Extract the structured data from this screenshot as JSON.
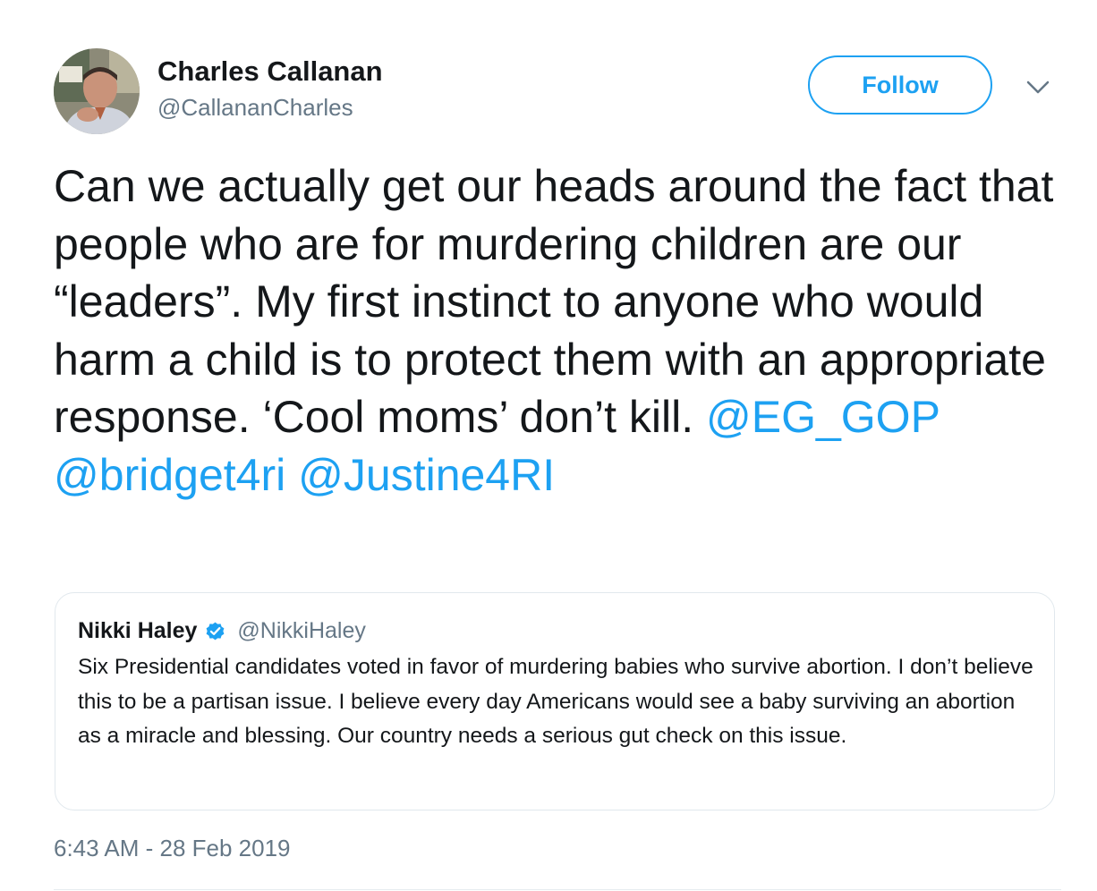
{
  "author": {
    "display_name": "Charles Callanan",
    "handle": "@CallananCharles"
  },
  "actions": {
    "follow_label": "Follow",
    "more_icon": "chevron-down-icon"
  },
  "tweet": {
    "text_parts": [
      "Can we actually get our heads around the fact that people who are for murdering children are our “leaders”.  My first instinct to anyone who would harm a child is to protect them with an appropriate response. ‘Cool moms’ don’t kill. "
    ],
    "mentions": [
      "@EG_GOP",
      "@bridget4ri",
      "@Justine4RI"
    ],
    "timestamp": "6:43 AM - 28 Feb 2019"
  },
  "quoted_tweet": {
    "name": "Nikki Haley",
    "verified": true,
    "handle": "@NikkiHaley",
    "text": "Six Presidential candidates voted in favor of murdering babies who survive abortion. I don’t believe this to be a partisan issue. I believe every day Americans would see a baby surviving an abortion as a miracle and blessing. Our country needs a serious gut check on this issue."
  },
  "colors": {
    "accent": "#1da1f2",
    "text_primary": "#14171a",
    "text_secondary": "#657786",
    "border": "#e1e8ed"
  }
}
